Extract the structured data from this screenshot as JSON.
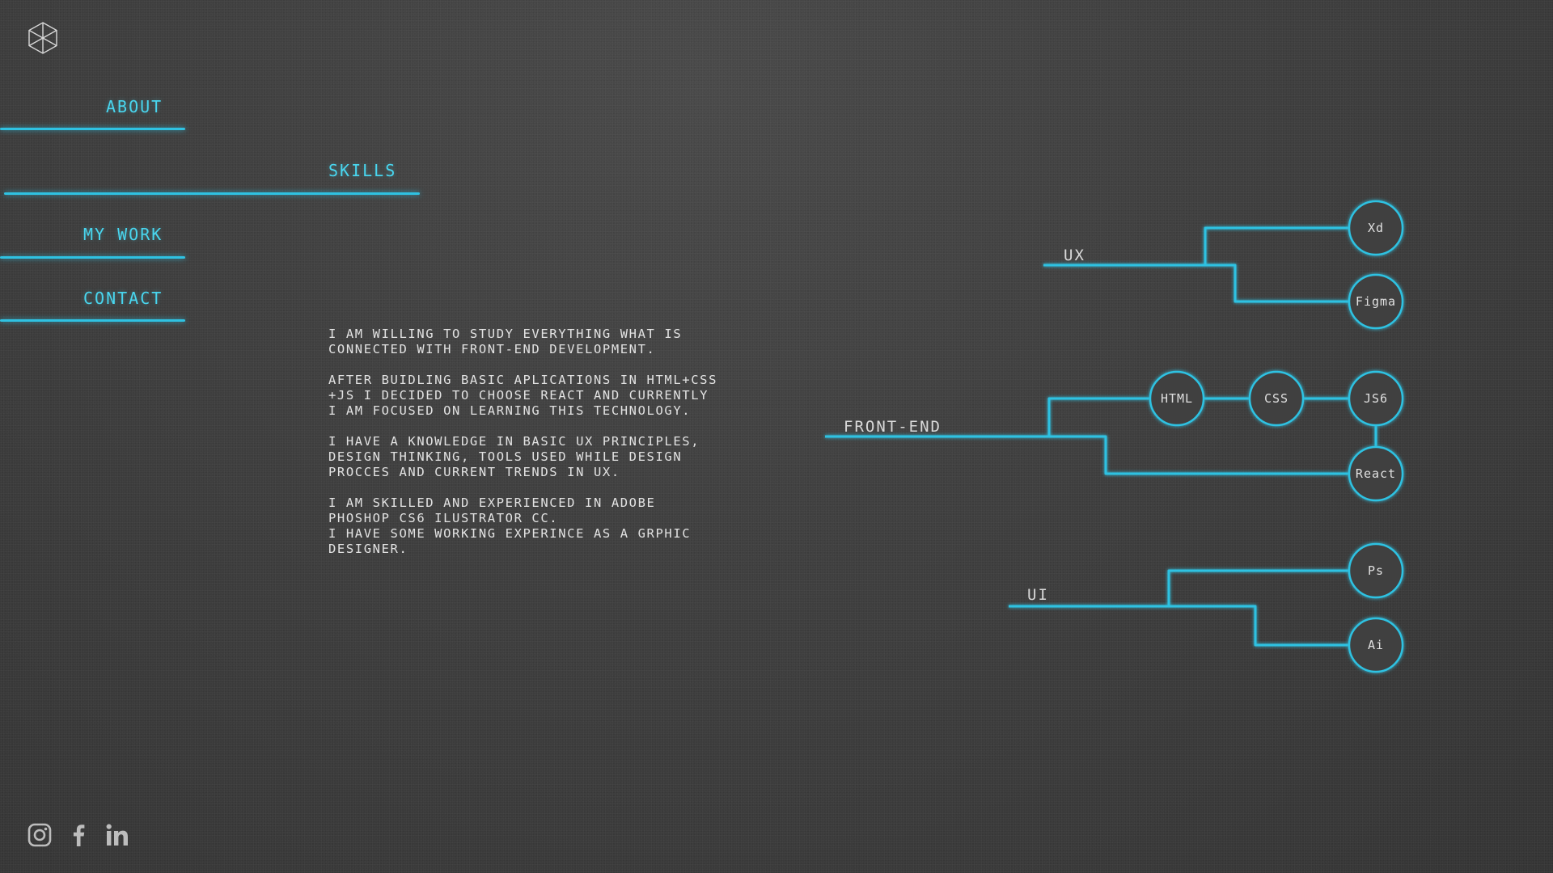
{
  "nav": {
    "items": [
      {
        "label": "ABOUT"
      },
      {
        "label": "SKILLS"
      },
      {
        "label": "MY WORK"
      },
      {
        "label": "CONTACT"
      }
    ]
  },
  "about": {
    "paragraphs": [
      "I AM WILLING TO STUDY EVERYTHING WHAT IS\nCONNECTED WITH FRONT-END DEVELOPMENT.",
      "AFTER BUIDLING BASIC APLICATIONS IN HTML+CSS\n+JS I DECIDED TO CHOOSE REACT AND CURRENTLY\nI AM FOCUSED ON LEARNING THIS TECHNOLOGY.",
      "I HAVE A KNOWLEDGE IN BASIC  UX PRINCIPLES,\nDESIGN THINKING, TOOLS USED WHILE DESIGN\nPROCCES AND CURRENT TRENDS IN UX.",
      "I AM  SKILLED AND EXPERIENCED IN ADOBE\nPHOSHOP CS6 ILUSTRATOR CC.\nI HAVE SOME WORKING EXPERINCE AS A GRPHIC\nDESIGNER."
    ]
  },
  "skills": {
    "groups": [
      {
        "label": "UX"
      },
      {
        "label": "FRONT-END"
      },
      {
        "label": "UI"
      }
    ],
    "nodes": [
      {
        "label": "Xd"
      },
      {
        "label": "Figma"
      },
      {
        "label": "HTML"
      },
      {
        "label": "CSS"
      },
      {
        "label": "JS6"
      },
      {
        "label": "React"
      },
      {
        "label": "Ps"
      },
      {
        "label": "Ai"
      }
    ]
  },
  "social": {
    "icons": [
      "instagram-icon",
      "facebook-icon",
      "linkedin-icon"
    ]
  },
  "colors": {
    "accent": "#49d6ef",
    "line": "#2fc2e2",
    "text": "#e2e2e2",
    "background": "#3f3f3f"
  }
}
